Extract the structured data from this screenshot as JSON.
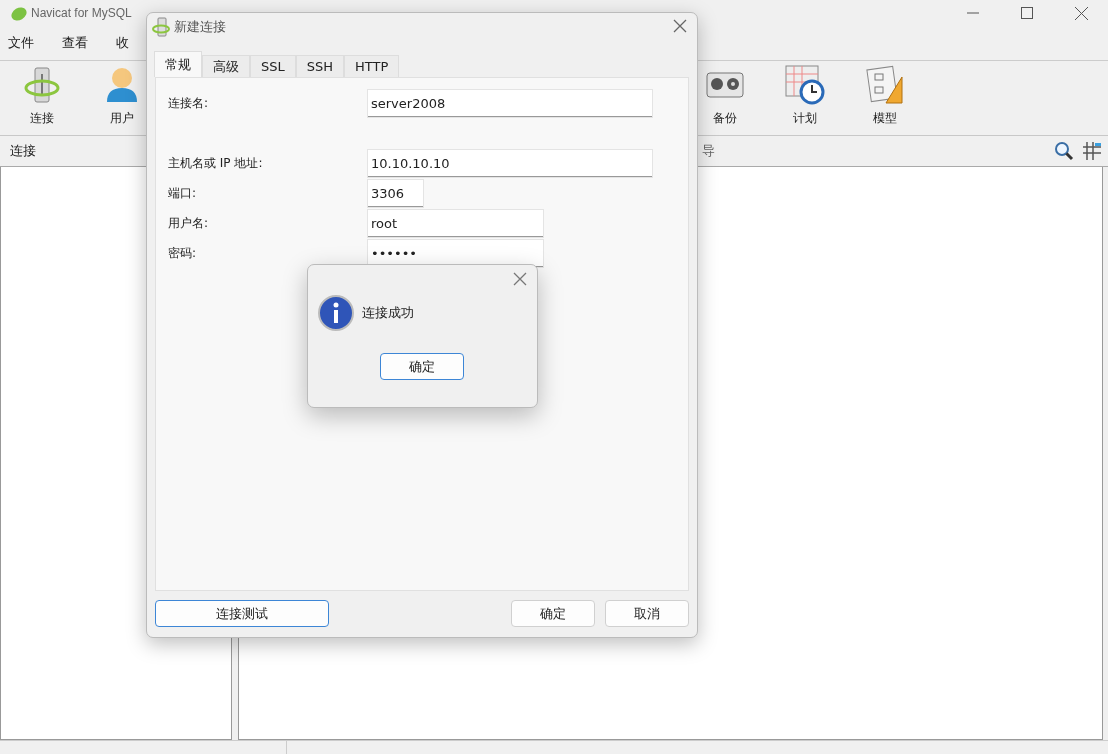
{
  "main_window": {
    "title": "Navicat for MySQL",
    "menu": [
      "文件",
      "查看",
      "收"
    ],
    "toolbar": [
      {
        "label": "连接",
        "kind": "connection"
      },
      {
        "label": "用户",
        "kind": "user"
      },
      {
        "label": "备份",
        "kind": "backup"
      },
      {
        "label": "计划",
        "kind": "schedule"
      },
      {
        "label": "模型",
        "kind": "model"
      }
    ],
    "left_header": "连接",
    "right_header": "导"
  },
  "dialog": {
    "title": "新建连接",
    "tabs": [
      {
        "label": "常规",
        "selected": true
      },
      {
        "label": "高级",
        "selected": false
      },
      {
        "label": "SSL",
        "selected": false
      },
      {
        "label": "SSH",
        "selected": false
      },
      {
        "label": "HTTP",
        "selected": false
      }
    ],
    "fields": [
      {
        "label": "连接名:",
        "value": "server2008",
        "kind": "wide"
      },
      {
        "label": "主机名或 IP 地址:",
        "value": "10.10.10.10",
        "kind": "wide"
      },
      {
        "label": "端口:",
        "value": "3306",
        "kind": "narrow"
      },
      {
        "label": "用户名:",
        "value": "root",
        "kind": "medium"
      },
      {
        "label": "密码:",
        "value": "••••••",
        "kind": "medium"
      }
    ],
    "test_button": "连接测试",
    "ok_button": "确定",
    "cancel_button": "取消"
  },
  "message_box": {
    "text": "连接成功",
    "button": "确定"
  }
}
